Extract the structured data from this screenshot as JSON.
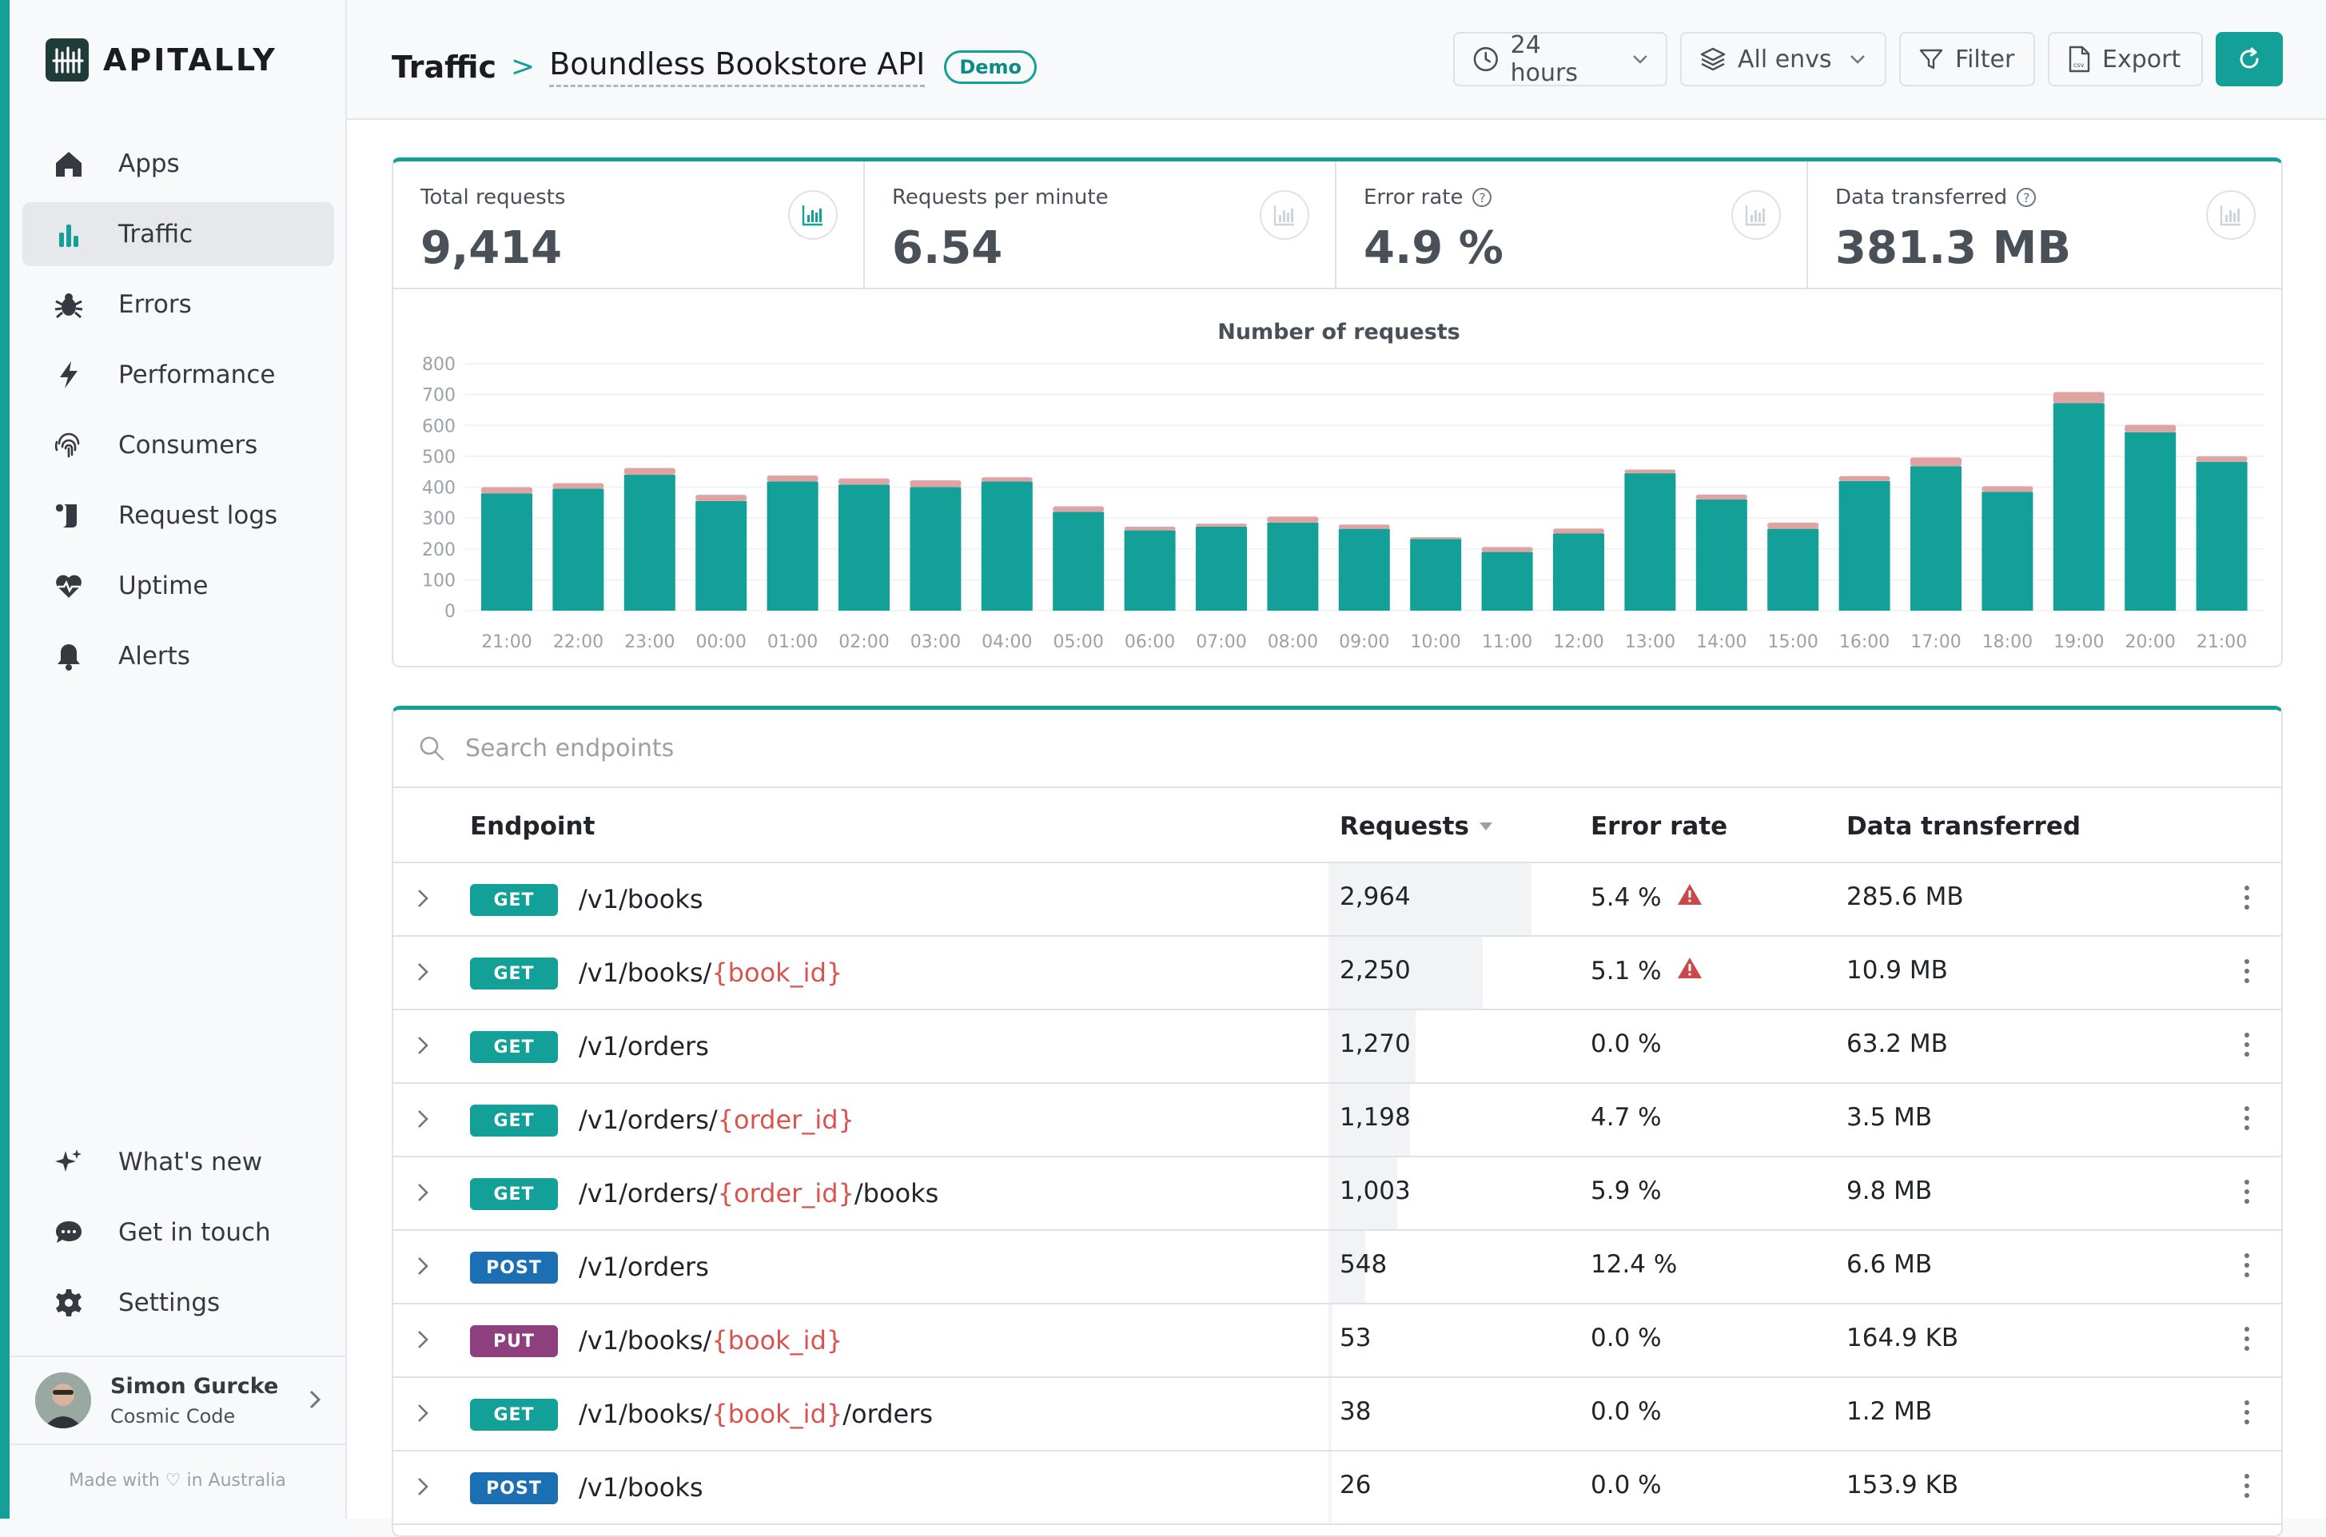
{
  "app": {
    "logo_text": "APITALLY"
  },
  "sidebar": {
    "items": [
      {
        "label": "Apps",
        "icon": "home-icon"
      },
      {
        "label": "Traffic",
        "icon": "bar-chart-icon"
      },
      {
        "label": "Errors",
        "icon": "bug-icon"
      },
      {
        "label": "Performance",
        "icon": "lightning-icon"
      },
      {
        "label": "Consumers",
        "icon": "fingerprint-icon"
      },
      {
        "label": "Request logs",
        "icon": "scroll-icon"
      },
      {
        "label": "Uptime",
        "icon": "heart-pulse-icon"
      },
      {
        "label": "Alerts",
        "icon": "bell-icon"
      }
    ],
    "bottom_items": [
      {
        "label": "What's new",
        "icon": "sparkles-icon"
      },
      {
        "label": "Get in touch",
        "icon": "chat-icon"
      },
      {
        "label": "Settings",
        "icon": "gear-icon"
      }
    ],
    "user": {
      "name": "Simon Gurcke",
      "org": "Cosmic Code"
    },
    "made_with": "Made with ♡ in Australia"
  },
  "header": {
    "section": "Traffic",
    "separator": ">",
    "app_name": "Boundless Bookstore API",
    "badge": "Demo",
    "period_label": "24 hours",
    "env_label": "All envs",
    "filter_label": "Filter",
    "export_label": "Export"
  },
  "stats": [
    {
      "label": "Total requests",
      "value": "9,414",
      "help": false
    },
    {
      "label": "Requests per minute",
      "value": "6.54",
      "help": false
    },
    {
      "label": "Error rate",
      "value": "4.9 %",
      "help": true
    },
    {
      "label": "Data transferred",
      "value": "381.3 MB",
      "help": true
    }
  ],
  "chart_data": {
    "type": "bar",
    "title": "Number of requests",
    "stacked": true,
    "categories": [
      "21:00",
      "22:00",
      "23:00",
      "00:00",
      "01:00",
      "02:00",
      "03:00",
      "04:00",
      "05:00",
      "06:00",
      "07:00",
      "08:00",
      "09:00",
      "10:00",
      "11:00",
      "12:00",
      "13:00",
      "14:00",
      "15:00",
      "16:00",
      "17:00",
      "18:00",
      "19:00",
      "20:00",
      "21:00"
    ],
    "series": [
      {
        "values": [
          380,
          395,
          440,
          355,
          418,
          408,
          400,
          418,
          320,
          260,
          272,
          285,
          265,
          232,
          190,
          250,
          445,
          360,
          265,
          420,
          468,
          385,
          672,
          578,
          482
        ],
        "color": "#12a099"
      },
      {
        "values": [
          20,
          18,
          22,
          20,
          20,
          20,
          22,
          14,
          18,
          12,
          10,
          20,
          14,
          6,
          16,
          16,
          12,
          16,
          20,
          16,
          28,
          18,
          36,
          24,
          18
        ],
        "color": "#e0a3a3"
      }
    ],
    "ylim": [
      0,
      800
    ],
    "yticks": [
      "800",
      "700",
      "600",
      "500",
      "400",
      "300",
      "200",
      "100",
      "0"
    ],
    "grid": true
  },
  "table": {
    "search_placeholder": "Search endpoints",
    "headers": {
      "endpoint": "Endpoint",
      "requests": "Requests",
      "error_rate": "Error rate",
      "data": "Data transferred"
    },
    "rows": [
      {
        "method": "GET",
        "path": [
          {
            "t": "/v1/books",
            "p": false
          }
        ],
        "requests": "2,964",
        "req_fraction": 1.0,
        "error_rate": "5.4 %",
        "warn": true,
        "data": "285.6 MB"
      },
      {
        "method": "GET",
        "path": [
          {
            "t": "/v1/books/",
            "p": false
          },
          {
            "t": "{book_id}",
            "p": true
          }
        ],
        "requests": "2,250",
        "req_fraction": 0.76,
        "error_rate": "5.1 %",
        "warn": true,
        "data": "10.9 MB"
      },
      {
        "method": "GET",
        "path": [
          {
            "t": "/v1/orders",
            "p": false
          }
        ],
        "requests": "1,270",
        "req_fraction": 0.43,
        "error_rate": "0.0 %",
        "warn": false,
        "data": "63.2 MB"
      },
      {
        "method": "GET",
        "path": [
          {
            "t": "/v1/orders/",
            "p": false
          },
          {
            "t": "{order_id}",
            "p": true
          }
        ],
        "requests": "1,198",
        "req_fraction": 0.4,
        "error_rate": "4.7 %",
        "warn": false,
        "data": "3.5 MB"
      },
      {
        "method": "GET",
        "path": [
          {
            "t": "/v1/orders/",
            "p": false
          },
          {
            "t": "{order_id}",
            "p": true
          },
          {
            "t": "/books",
            "p": false
          }
        ],
        "requests": "1,003",
        "req_fraction": 0.34,
        "error_rate": "5.9 %",
        "warn": false,
        "data": "9.8 MB"
      },
      {
        "method": "POST",
        "path": [
          {
            "t": "/v1/orders",
            "p": false
          }
        ],
        "requests": "548",
        "req_fraction": 0.18,
        "error_rate": "12.4 %",
        "warn": false,
        "data": "6.6 MB"
      },
      {
        "method": "PUT",
        "path": [
          {
            "t": "/v1/books/",
            "p": false
          },
          {
            "t": "{book_id}",
            "p": true
          }
        ],
        "requests": "53",
        "req_fraction": 0.02,
        "error_rate": "0.0 %",
        "warn": false,
        "data": "164.9 KB"
      },
      {
        "method": "GET",
        "path": [
          {
            "t": "/v1/books/",
            "p": false
          },
          {
            "t": "{book_id}",
            "p": true
          },
          {
            "t": "/orders",
            "p": false
          }
        ],
        "requests": "38",
        "req_fraction": 0.013,
        "error_rate": "0.0 %",
        "warn": false,
        "data": "1.2 MB"
      },
      {
        "method": "POST",
        "path": [
          {
            "t": "/v1/books",
            "p": false
          }
        ],
        "requests": "26",
        "req_fraction": 0.009,
        "error_rate": "0.0 %",
        "warn": false,
        "data": "153.9 KB"
      }
    ]
  },
  "colors": {
    "accent": "#12a099",
    "GET": "#12a099",
    "POST": "#1c6fb3",
    "PUT": "#8e3f7d",
    "error_bar": "#e0a3a3",
    "warn": "#c9484a"
  }
}
